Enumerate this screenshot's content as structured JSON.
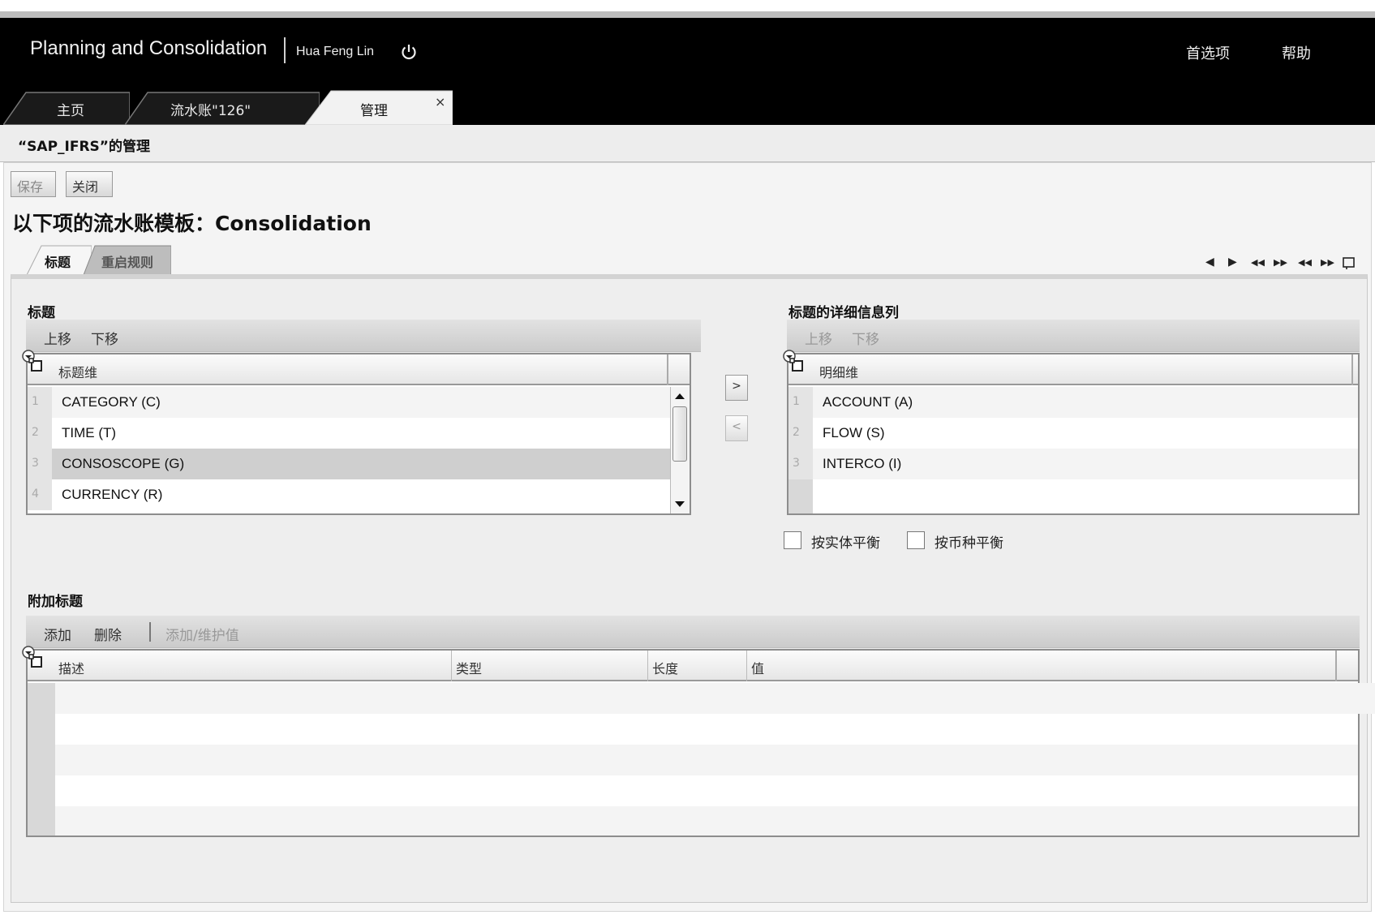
{
  "header": {
    "app_title": "Planning and Consolidation",
    "user_name": "Hua Feng Lin",
    "preferences": "首选项",
    "help": "帮助"
  },
  "tabs": [
    {
      "label": "主页"
    },
    {
      "label": "流水账\"126\""
    },
    {
      "label": "管理",
      "close": "×"
    }
  ],
  "title_bar": "“SAP_IFRS”的管理",
  "toolbar": {
    "save": "保存",
    "close": "关闭"
  },
  "page_title": "以下项的流水账模板：Consolidation",
  "subtabs": [
    {
      "label": "标题"
    },
    {
      "label": "重启规则"
    }
  ],
  "pager": {
    "prev": "◀",
    "next": "▶",
    "first": "◀◀",
    "last": "▶▶",
    "first_page": "◀◀",
    "last_page": "▶▶"
  },
  "header_section": {
    "title": "标题",
    "move_up": "上移",
    "move_down": "下移",
    "column": "标题维",
    "rows": [
      {
        "num": "1",
        "value": "CATEGORY (C)"
      },
      {
        "num": "2",
        "value": "TIME (T)"
      },
      {
        "num": "3",
        "value": "CONSOSCOPE (G)"
      },
      {
        "num": "4",
        "value": "CURRENCY (R)"
      }
    ]
  },
  "transfer": {
    "add": ">",
    "remove": "<"
  },
  "detail_section": {
    "title": "标题的详细信息列",
    "move_up": "上移",
    "move_down": "下移",
    "column": "明细维",
    "rows": [
      {
        "num": "1",
        "value": "ACCOUNT (A)"
      },
      {
        "num": "2",
        "value": "FLOW (S)"
      },
      {
        "num": "3",
        "value": "INTERCO (I)"
      }
    ],
    "balance_by_entity": "按实体平衡",
    "balance_by_currency": "按币种平衡"
  },
  "additional_section": {
    "title": "附加标题",
    "add": "添加",
    "delete": "删除",
    "add_maintain_value": "添加/维护值",
    "columns": [
      "描述",
      "类型",
      "长度",
      "值"
    ]
  }
}
